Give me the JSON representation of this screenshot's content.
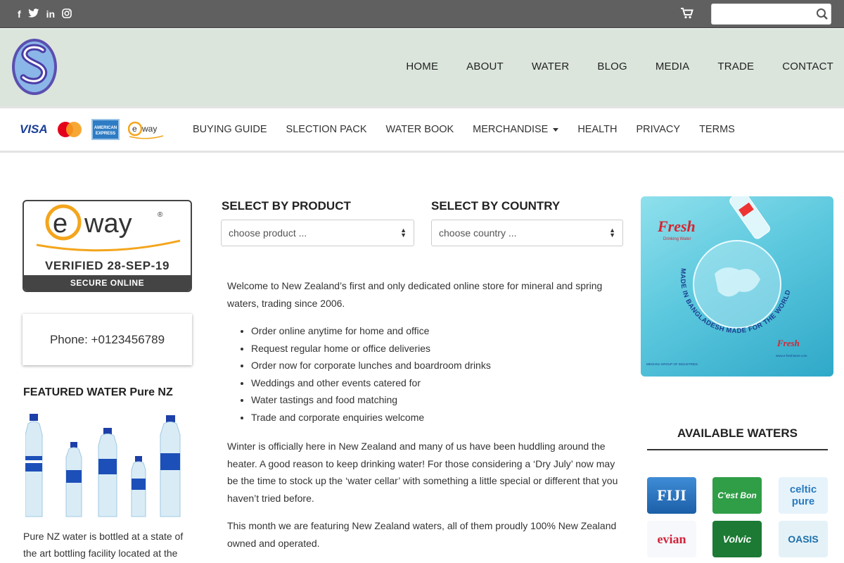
{
  "topbar": {
    "social": [
      "f",
      "t",
      "in",
      "ig"
    ],
    "search": {
      "placeholder": "",
      "value": ""
    }
  },
  "main_nav": [
    "HOME",
    "ABOUT",
    "WATER",
    "BLOG",
    "MEDIA",
    "TRADE",
    "CONTACT"
  ],
  "payment_cards": {
    "visa": "VISA",
    "mastercard": "MasterCard",
    "amex": "AMERICAN EXPRESS",
    "eway": "eway"
  },
  "sub_nav": [
    "BUYING GUIDE",
    "SLECTION PACK",
    "WATER BOOK",
    "MERCHANDISE",
    "HEALTH",
    "PRIVACY",
    "TERMS"
  ],
  "eway_badge": {
    "logo": "eway",
    "verified": "VERIFIED 28-SEP-19",
    "secure": "SECURE ONLINE"
  },
  "phone": "Phone: +0123456789",
  "featured": {
    "title": "FEATURED WATER Pure NZ",
    "desc": "Pure NZ water is bottled at a state of the art bottling facility located at the source"
  },
  "select_product": {
    "label": "SELECT BY PRODUCT",
    "value": "choose product ..."
  },
  "select_country": {
    "label": "SELECT BY COUNTRY",
    "value": "choose country ..."
  },
  "content": {
    "intro": "Welcome to New Zealand’s first and only dedicated online store for mineral and spring waters, trading since 2006.",
    "bullets": [
      "Order online anytime for home and office",
      "Request regular home or office deliveries",
      "Order now for corporate lunches and boardroom drinks",
      "Weddings and other events catered for",
      "Water tastings and food matching",
      "Trade and corporate enquiries welcome"
    ],
    "para2": "Winter is officially here in New Zealand and many of us have been huddling around the heater. A good reason to keep drinking water! For those considering a ‘Dry July’ now may be the time to stock up the ‘water cellar’ with something a little special or different that you haven’t tried before.",
    "para3": "This month we are featuring New Zealand waters, all of them proudly 100% New Zealand owned and operated."
  },
  "ad": {
    "brand": "Fresh",
    "tagline": "Drinking Water",
    "arc_text": "MADE IN BANGLADESH MADE FOR THE WORLD",
    "small_brand": "Fresh",
    "footer_left": "MEGHNA GROUP OF INDUSTRIES",
    "footer_right": "www.e-freshstore.com"
  },
  "available": {
    "title": "AVAILABLE WATERS",
    "brands": [
      "FIJI",
      "C'est Bon",
      "celtic pure",
      "evian",
      "Volvic",
      "OASIS"
    ]
  },
  "colors": {
    "topbar": "#606060",
    "header": "#dbe5dc",
    "ad": "#5cc8de"
  }
}
